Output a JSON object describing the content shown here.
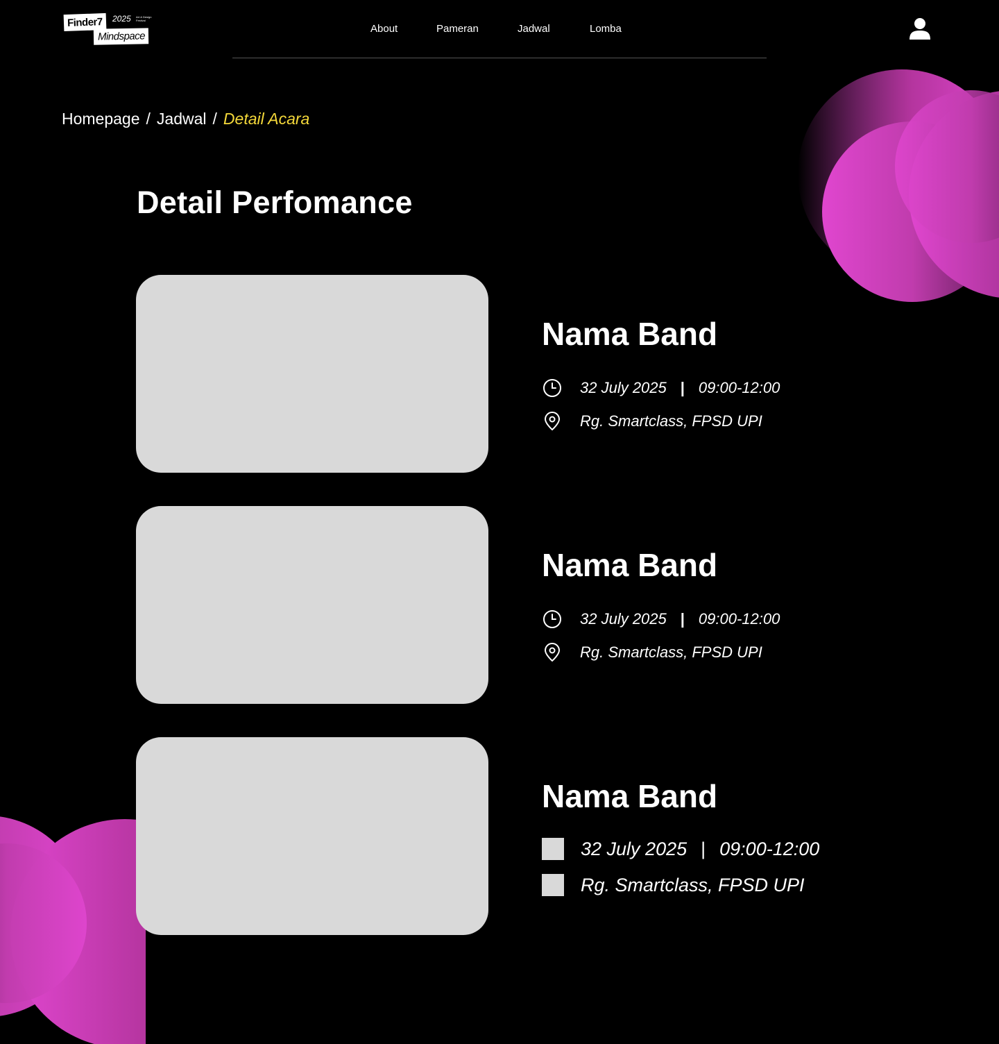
{
  "colors": {
    "background": "#000000",
    "accent_yellow": "#f5d93a",
    "accent_pink": "#e046cf",
    "placeholder_gray": "#d9d9d9",
    "text": "#ffffff"
  },
  "logo": {
    "primary": "Finder7",
    "year": "2025",
    "tagline": "Art & Design Festival",
    "secondary": "Mindspace"
  },
  "nav": {
    "items": [
      {
        "label": "About"
      },
      {
        "label": "Pameran"
      },
      {
        "label": "Jadwal"
      },
      {
        "label": "Lomba"
      }
    ],
    "user_icon": "user-icon"
  },
  "breadcrumb": {
    "items": [
      "Homepage",
      "Jadwal"
    ],
    "separator": "/",
    "current": "Detail Acara"
  },
  "page_title": "Detail Perfomance",
  "performances": [
    {
      "name": "Nama Band",
      "date": "32 July 2025",
      "separator": "|",
      "time": "09:00-12:00",
      "location": "Rg. Smartclass, FPSD UPI",
      "time_icon": "clock-icon",
      "location_icon": "location-pin-icon"
    },
    {
      "name": "Nama Band",
      "date": "32 July 2025",
      "separator": "|",
      "time": "09:00-12:00",
      "location": "Rg. Smartclass, FPSD UPI",
      "time_icon": "clock-icon",
      "location_icon": "location-pin-icon"
    },
    {
      "name": "Nama Band",
      "date": "32 July 2025",
      "separator": "|",
      "time": "09:00-12:00",
      "location": "Rg. Smartclass, FPSD UPI",
      "time_icon": "placeholder-square",
      "location_icon": "placeholder-square"
    }
  ]
}
